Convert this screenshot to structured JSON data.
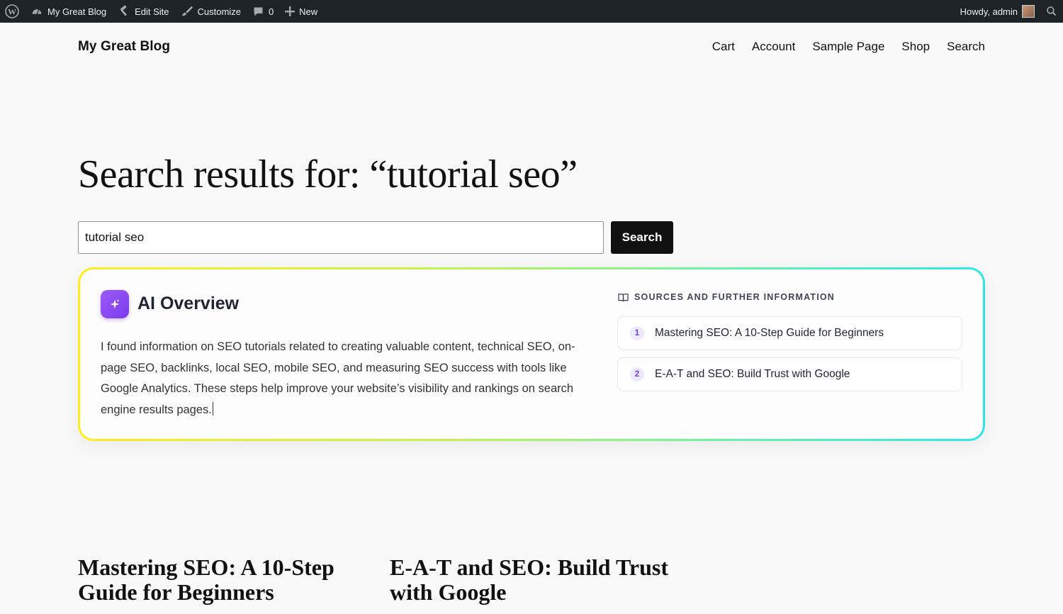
{
  "admin_bar": {
    "site_name": "My Great Blog",
    "edit_site": "Edit Site",
    "customize": "Customize",
    "comments_count": "0",
    "new": "New",
    "greeting": "Howdy, admin"
  },
  "site": {
    "title": "My Great Blog",
    "nav": [
      "Cart",
      "Account",
      "Sample Page",
      "Shop",
      "Search"
    ]
  },
  "page": {
    "heading": "Search results for: “tutorial seo”"
  },
  "search": {
    "value": "tutorial seo",
    "button_label": "Search"
  },
  "ai_overview": {
    "title": "AI Overview",
    "text": "I found information on SEO tutorials related to creating valuable content, technical SEO, on-page SEO, backlinks, local SEO, mobile SEO, and measuring SEO success with tools like Google Analytics. These steps help improve your website’s visibility and rankings on search engine results pages.",
    "sources_heading": "SOURCES AND FURTHER INFORMATION",
    "sources": [
      {
        "number": "1",
        "label": "Mastering SEO: A 10-Step Guide for Beginners"
      },
      {
        "number": "2",
        "label": "E-A-T and SEO: Build Trust with Google"
      }
    ]
  },
  "posts": [
    {
      "title": "Mastering SEO: A 10-Step Guide for Beginners"
    },
    {
      "title": "E-A-T and SEO: Build Trust with Google"
    }
  ],
  "colors": {
    "admin_bar_bg": "#1d2327",
    "accent_purple": "#7c3aed",
    "gradient_start": "#ffee1f",
    "gradient_end": "#2fe6e6"
  }
}
